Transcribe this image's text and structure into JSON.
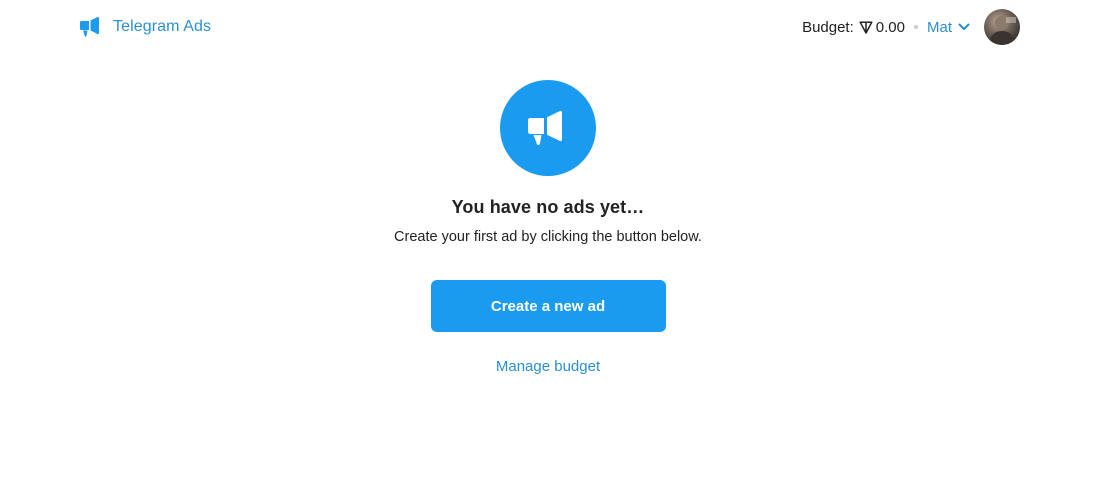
{
  "header": {
    "brand_name": "Telegram Ads",
    "budget_label": "Budget:",
    "budget_value": "0.00",
    "user_name": "Mat"
  },
  "main": {
    "title": "You have no ads yet…",
    "subtitle": "Create your first ad by clicking the button below.",
    "create_button_label": "Create a new ad",
    "manage_budget_label": "Manage budget"
  },
  "icons": {
    "brand": "megaphone-icon",
    "currency": "ton-icon",
    "user_menu": "chevron-down-icon",
    "hero": "megaphone-icon"
  },
  "colors": {
    "accent": "#1a9bf0",
    "link": "#2a8fd3",
    "text": "#222222",
    "background": "#ffffff"
  }
}
